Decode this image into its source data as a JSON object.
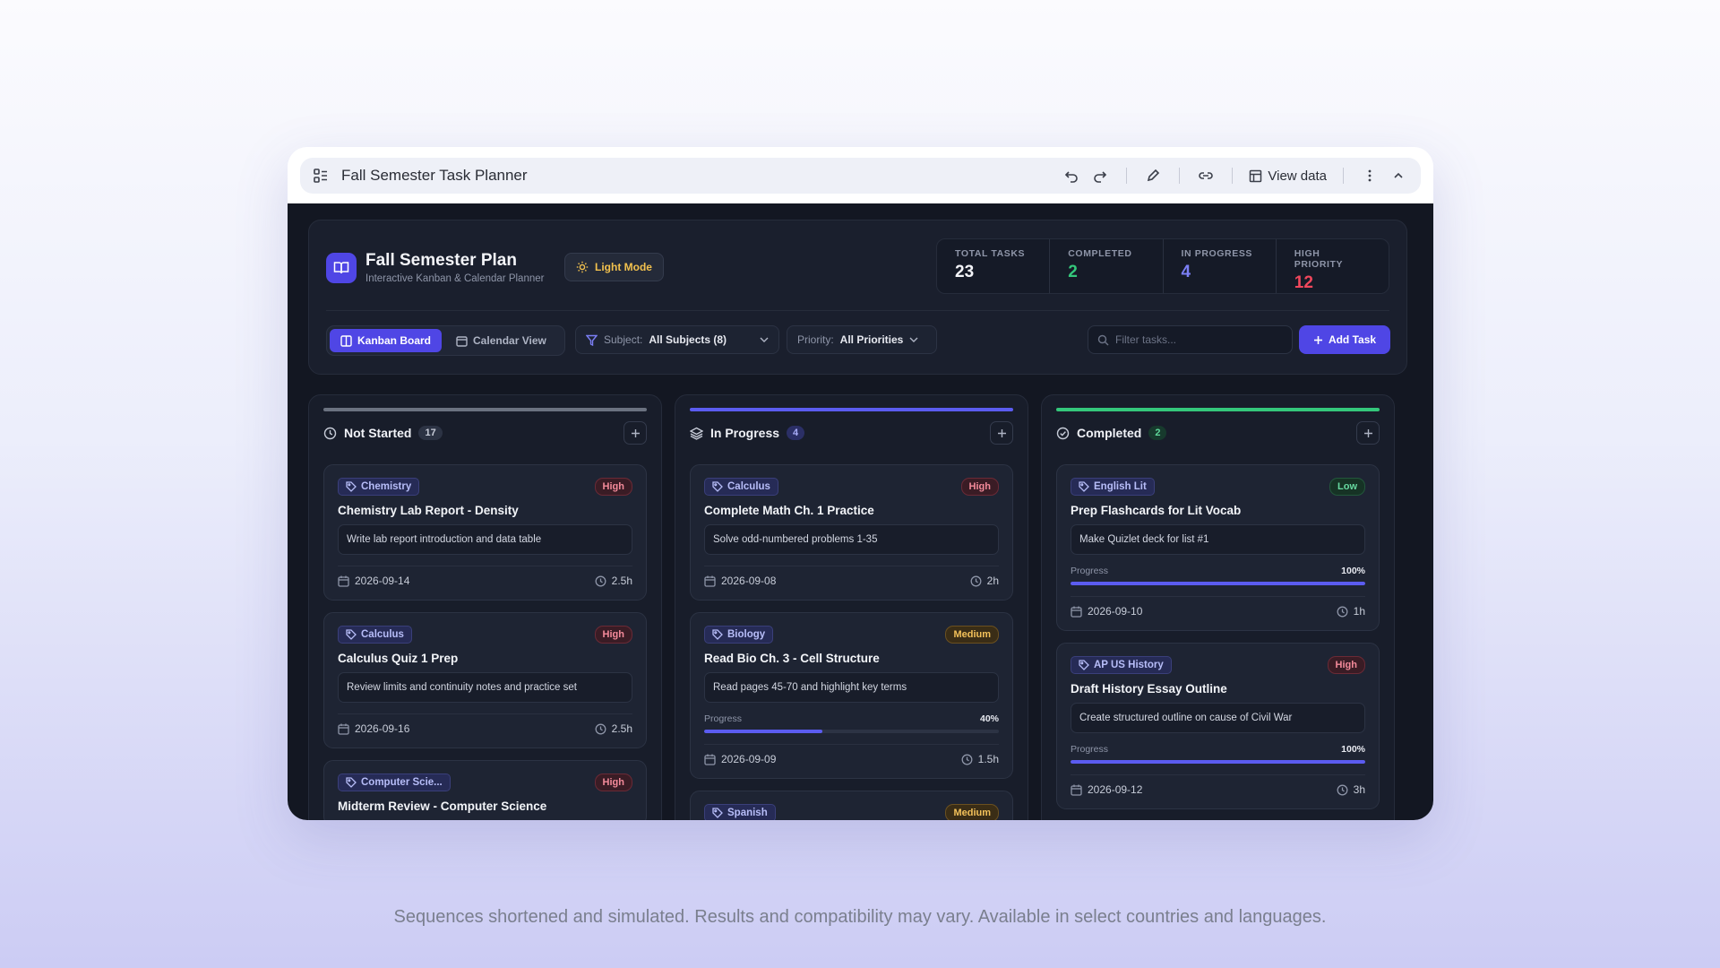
{
  "window": {
    "title": "Fall Semester Task Planner",
    "view_data_label": "View data"
  },
  "app": {
    "brand_title": "Fall Semester Plan",
    "brand_subtitle": "Interactive Kanban & Calendar Planner",
    "theme_toggle_label": "Light Mode",
    "stats": [
      {
        "label": "TOTAL TASKS",
        "value": "23",
        "color": "#f3f4f8"
      },
      {
        "label": "COMPLETED",
        "value": "2",
        "color": "#34c77b"
      },
      {
        "label": "IN PROGRESS",
        "value": "4",
        "color": "#7b7ff5"
      },
      {
        "label": "HIGH PRIORITY",
        "value": "12",
        "color": "#f0475c"
      }
    ],
    "views": {
      "kanban": "Kanban Board",
      "calendar": "Calendar View"
    },
    "subject_filter": {
      "label": "Subject:",
      "value": "All Subjects (8)"
    },
    "priority_filter": {
      "label": "Priority:",
      "value": "All Priorities"
    },
    "search_placeholder": "Filter tasks...",
    "add_task_label": "Add Task"
  },
  "columns": [
    {
      "title": "Not Started",
      "count": "17",
      "bar_color": "#6b7280",
      "count_bg": "#2c3344",
      "count_color": "#c7ccd8",
      "cards": [
        {
          "subject": "Chemistry",
          "priority": "High",
          "title": "Chemistry Lab Report - Density",
          "desc": "Write lab report introduction and data table",
          "date": "2026-09-14",
          "hours": "2.5h"
        },
        {
          "subject": "Calculus",
          "priority": "High",
          "title": "Calculus Quiz 1 Prep",
          "desc": "Review limits and continuity notes and practice set",
          "date": "2026-09-16",
          "hours": "2.5h"
        },
        {
          "subject": "Computer Scie...",
          "priority": "High",
          "title": "Midterm Review - Computer Science",
          "desc": "",
          "date": "",
          "hours": ""
        }
      ]
    },
    {
      "title": "In Progress",
      "count": "4",
      "bar_color": "#5b5cf0",
      "count_bg": "#2b2f66",
      "count_color": "#a9adf9",
      "cards": [
        {
          "subject": "Calculus",
          "priority": "High",
          "title": "Complete Math Ch. 1 Practice",
          "desc": "Solve odd-numbered problems 1-35",
          "date": "2026-09-08",
          "hours": "2h"
        },
        {
          "subject": "Biology",
          "priority": "Medium",
          "title": "Read Bio Ch. 3 - Cell Structure",
          "desc": "Read pages 45-70 and highlight key terms",
          "progress_label": "Progress",
          "progress": "40%",
          "progress_value": 40,
          "date": "2026-09-09",
          "hours": "1.5h"
        },
        {
          "subject": "Spanish",
          "priority": "Medium",
          "title": "",
          "desc": "",
          "date": "",
          "hours": ""
        }
      ]
    },
    {
      "title": "Completed",
      "count": "2",
      "bar_color": "#34c77b",
      "count_bg": "#173a2d",
      "count_color": "#5fd79a",
      "cards": [
        {
          "subject": "English Lit",
          "priority": "Low",
          "title": "Prep Flashcards for Lit Vocab",
          "desc": "Make Quizlet deck for list #1",
          "progress_label": "Progress",
          "progress": "100%",
          "progress_value": 100,
          "date": "2026-09-10",
          "hours": "1h"
        },
        {
          "subject": "AP US History",
          "priority": "High",
          "title": "Draft History Essay Outline",
          "desc": "Create structured outline on cause of Civil War",
          "progress_label": "Progress",
          "progress": "100%",
          "progress_value": 100,
          "date": "2026-09-12",
          "hours": "3h"
        }
      ]
    }
  ],
  "priority_colors": {
    "High": {
      "bg": "#3a1c25",
      "border": "#6b2a36",
      "color": "#f38a9a"
    },
    "Medium": {
      "bg": "#3a2d16",
      "border": "#6b5020",
      "color": "#f3c15a"
    },
    "Low": {
      "bg": "#163325",
      "border": "#23573c",
      "color": "#67d9a0"
    }
  },
  "footer_note": "Sequences shortened and simulated. Results and compatibility may vary. Available in select countries and languages."
}
